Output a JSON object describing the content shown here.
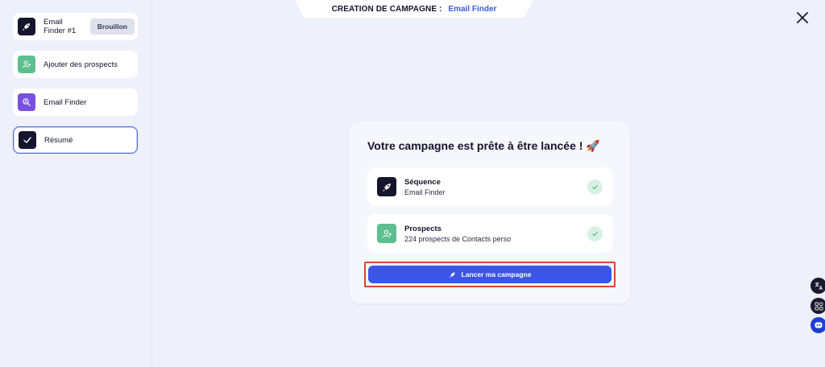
{
  "header": {
    "label": "CREATION DE CAMPAGNE :",
    "campaign_type": "Email Finder"
  },
  "sidebar": {
    "steps": [
      {
        "label": "Email Finder #1",
        "badge": "Brouillon",
        "icon": "rocket-icon"
      },
      {
        "label": "Ajouter des prospects",
        "icon": "add-user-icon"
      },
      {
        "label": "Email Finder",
        "icon": "search-user-icon"
      },
      {
        "label": "Résumé",
        "icon": "check-icon"
      }
    ]
  },
  "summary": {
    "title": "Votre campagne est prête à être lancée ! 🚀",
    "items": [
      {
        "title": "Séquence",
        "subtitle": "Email Finder",
        "icon": "rocket-icon",
        "status": "complete"
      },
      {
        "title": "Prospects",
        "subtitle": "224 prospects de Contacts perso",
        "icon": "add-user-icon",
        "status": "complete"
      }
    ],
    "launch_label": "Lancer ma campagne"
  },
  "floating_buttons": [
    "translate-icon",
    "apps-icon",
    "chat-bot-icon"
  ],
  "colors": {
    "background": "#eef0fb",
    "accent": "#3c55e6",
    "highlight_border": "#e0432f",
    "success": "#5cbf8f"
  }
}
